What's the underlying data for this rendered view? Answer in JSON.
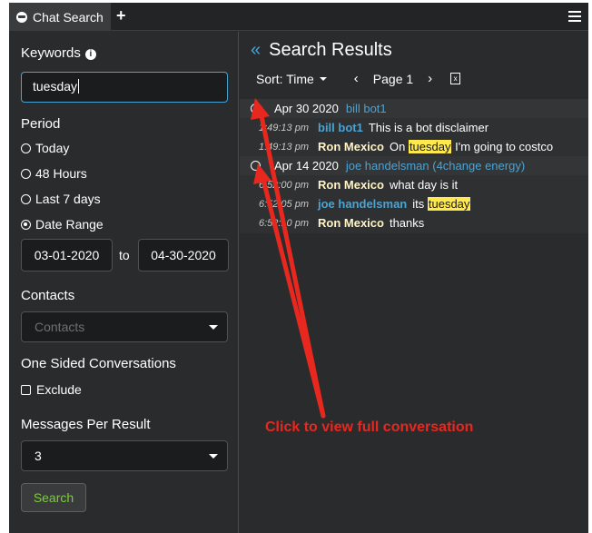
{
  "tabbar": {
    "tab_label": "Chat Search",
    "add_label": "+"
  },
  "filters": {
    "keywords_label": "Keywords",
    "keywords_value": "tuesday",
    "period_label": "Period",
    "period_options": [
      "Today",
      "48 Hours",
      "Last 7 days",
      "Date Range"
    ],
    "period_selected": "Date Range",
    "date_from": "03-01-2020",
    "date_to_label": "to",
    "date_to": "04-30-2020",
    "contacts_label": "Contacts",
    "contacts_placeholder": "Contacts",
    "one_sided_label": "One Sided Conversations",
    "exclude_label": "Exclude",
    "messages_per_result_label": "Messages Per Result",
    "messages_per_result_value": "3",
    "search_button": "Search"
  },
  "results": {
    "title": "Search Results",
    "back_chevron": "«",
    "sort_label": "Sort: Time",
    "page_label": "Page 1",
    "prev": "‹",
    "next": "›",
    "groups": [
      {
        "date": "Apr 30 2020",
        "participant": "bill bot1",
        "messages": [
          {
            "time": "1:49:13 pm",
            "sender": "bill bot1",
            "text": "This is a bot disclaimer"
          },
          {
            "time": "1:49:13 pm",
            "sender": "Ron Mexico",
            "text_pre": "On ",
            "highlight": "tuesday",
            "text_post": " I'm going to costco"
          }
        ]
      },
      {
        "date": "Apr 14 2020",
        "participant": "joe handelsman (4change energy)",
        "messages": [
          {
            "time": "6:52:00 pm",
            "sender": "Ron Mexico",
            "text": "what day is it"
          },
          {
            "time": "6:52:05 pm",
            "sender": "joe handelsman",
            "text_pre": "its ",
            "highlight": "tuesday"
          },
          {
            "time": "6:52:10 pm",
            "sender": "Ron Mexico",
            "text": "thanks"
          }
        ]
      }
    ]
  },
  "annotation": {
    "text": "Click to view full conversation",
    "color": "#e8281f"
  },
  "colors": {
    "accent": "#4ba3d3",
    "highlight": "#ffe94d",
    "search_text": "#7ccc3a"
  }
}
